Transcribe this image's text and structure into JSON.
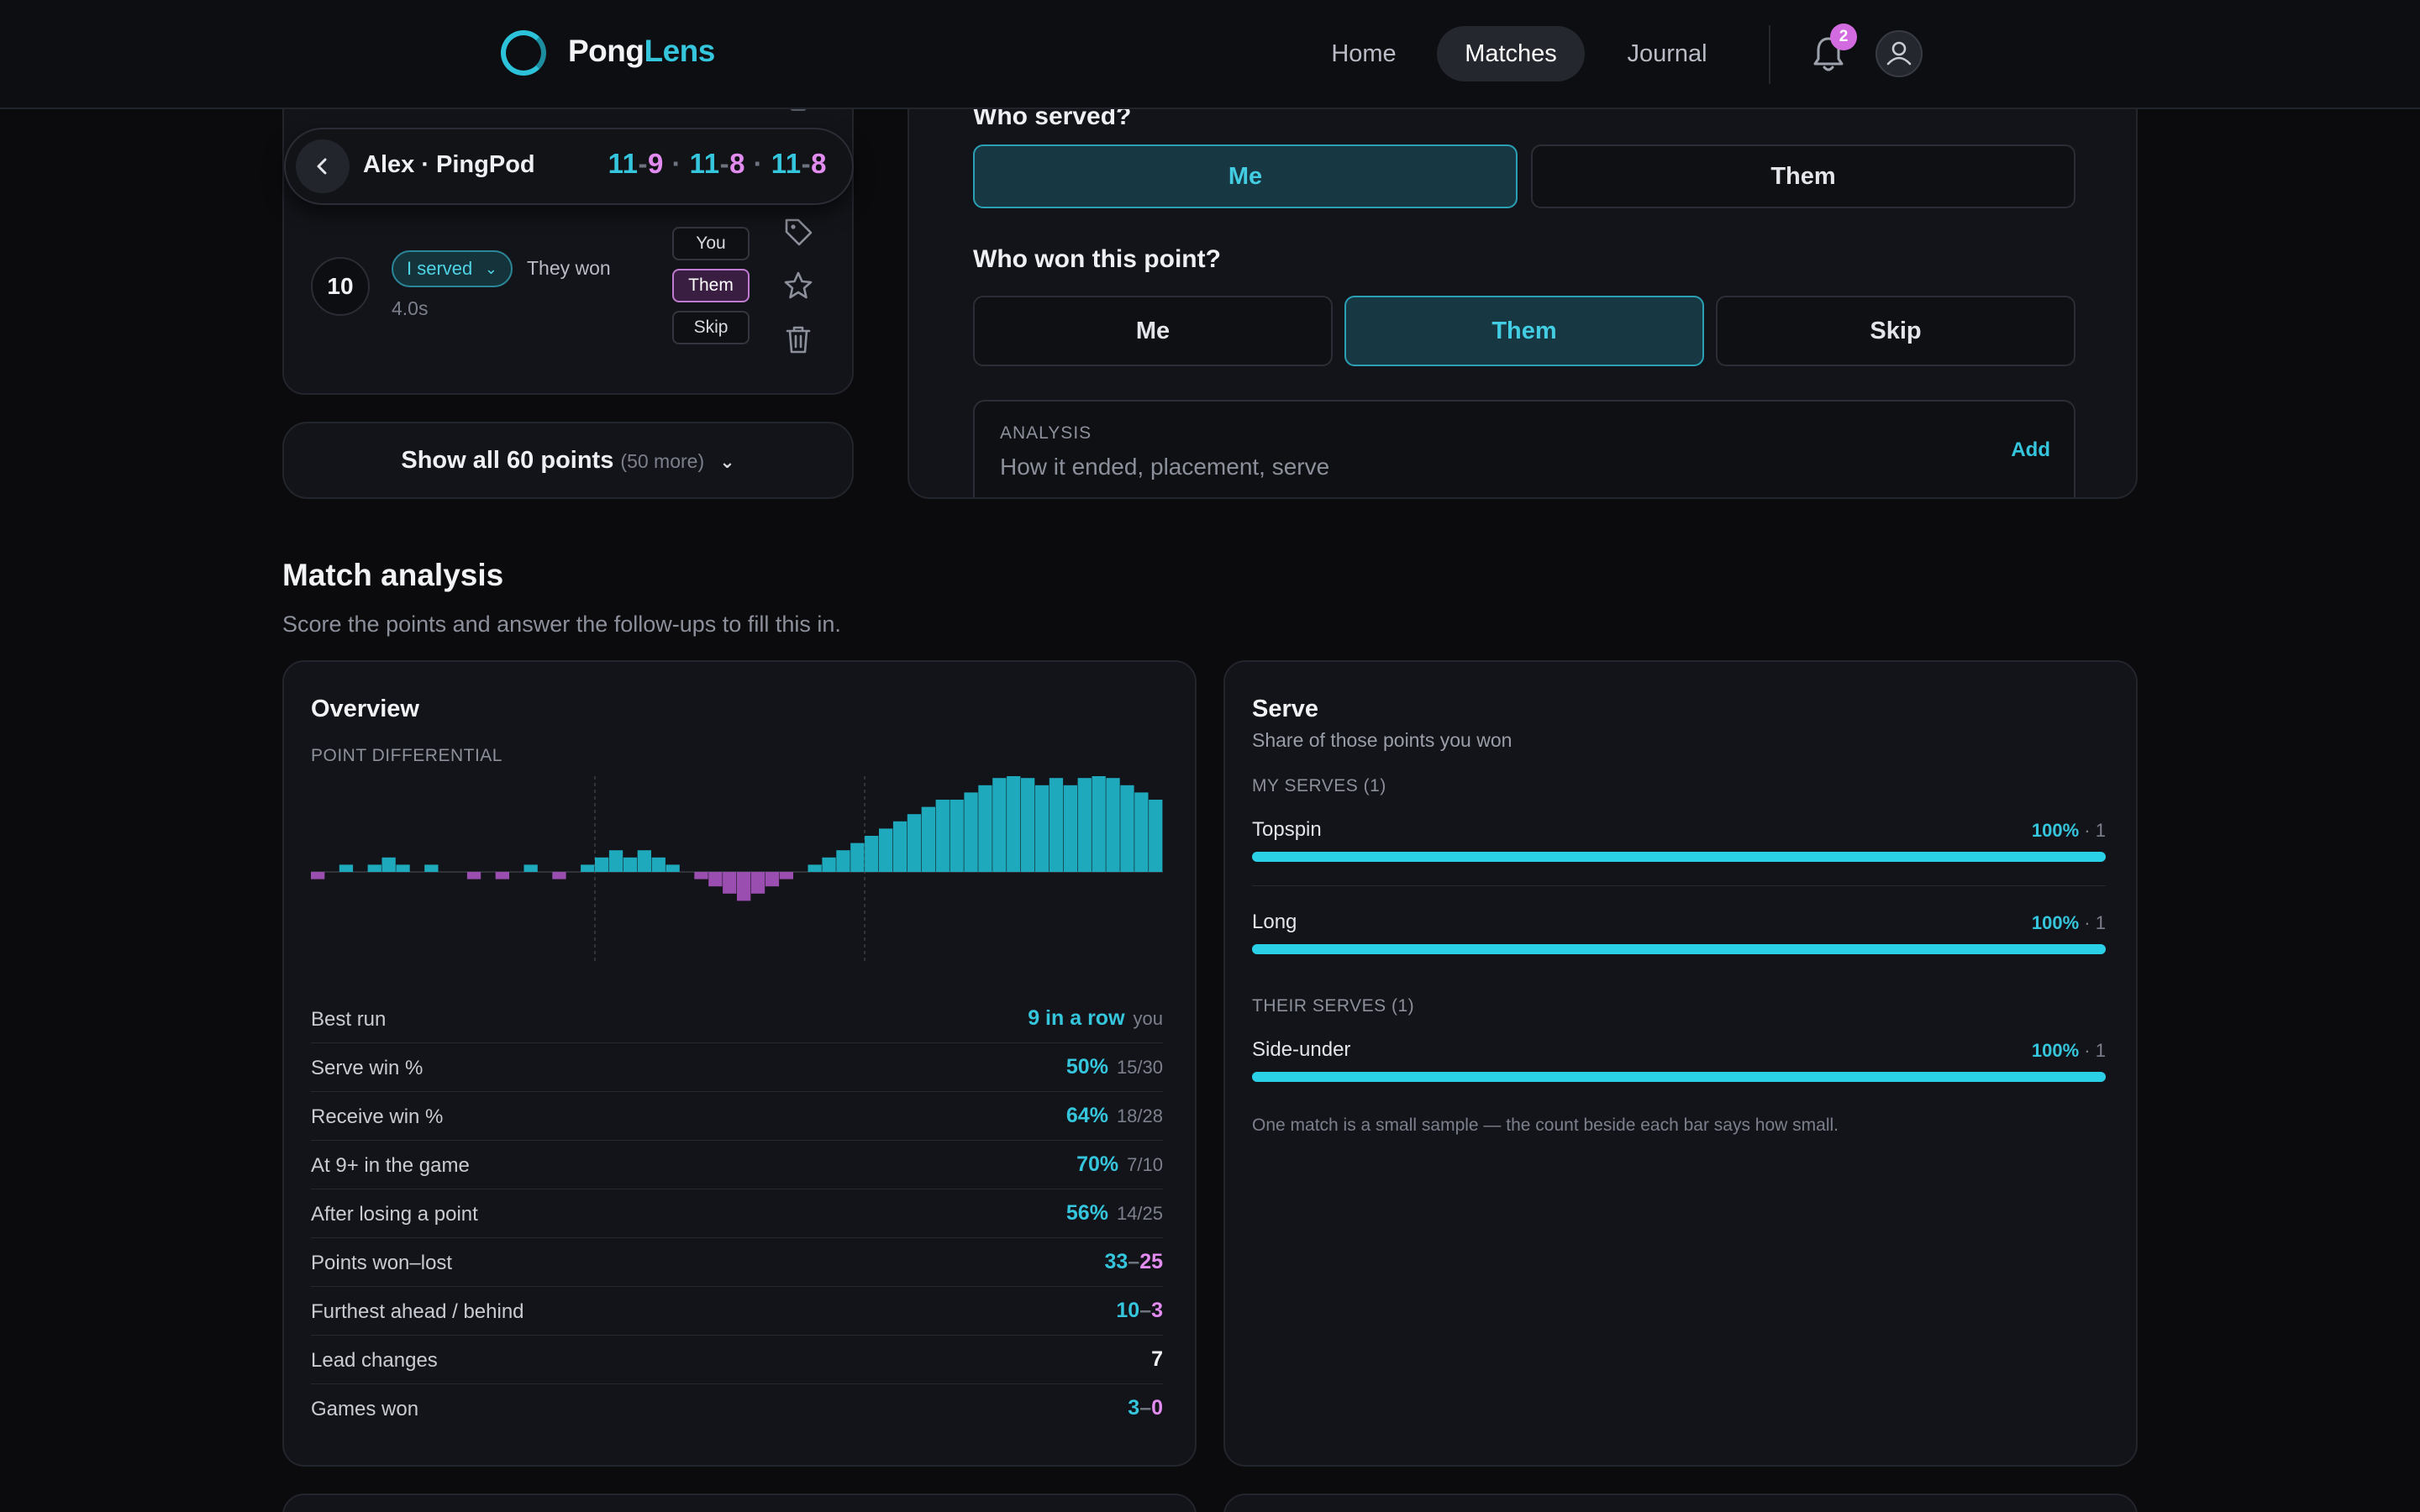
{
  "nav": {
    "brand_a": "Pong",
    "brand_b": "Lens",
    "links": [
      "Home",
      "Matches",
      "Journal"
    ],
    "notifications": "2",
    "icons": {
      "bell": "bell-icon",
      "avatar": "user-icon"
    }
  },
  "match_pill": {
    "title": "Alex · PingPod",
    "games": [
      {
        "me": "11",
        "them": "9"
      },
      {
        "me": "11",
        "them": "8"
      },
      {
        "me": "11",
        "them": "8"
      }
    ]
  },
  "point": {
    "number": "10",
    "served_chip": "I served",
    "result": "They won",
    "duration": "4.0s",
    "answers": [
      "You",
      "Them",
      "Skip"
    ],
    "selected_answer": "Them"
  },
  "show_all": {
    "label": "Show all 60 points",
    "more": "(50 more)"
  },
  "editor": {
    "q1": "Who served?",
    "q1_options": [
      "Me",
      "Them"
    ],
    "q1_selected": "Me",
    "q2": "Who won this point?",
    "q2_options": [
      "Me",
      "Them",
      "Skip"
    ],
    "q2_selected": "Them",
    "analysis_label": "ANALYSIS",
    "analysis_placeholder": "How it ended, placement, serve",
    "analysis_add": "Add"
  },
  "match_analysis": {
    "title": "Match analysis",
    "subtitle": "Score the points and answer the follow-ups to fill this in."
  },
  "overview": {
    "title": "Overview",
    "diff_label": "POINT DIFFERENTIAL",
    "stats": [
      {
        "label": "Best run",
        "value": "9 in a row",
        "sub": "you"
      },
      {
        "label": "Serve win %",
        "value": "50%",
        "sub": "15/30"
      },
      {
        "label": "Receive win %",
        "value": "64%",
        "sub": "18/28"
      },
      {
        "label": "At 9+ in the game",
        "value": "70%",
        "sub": "7/10"
      },
      {
        "label": "After losing a point",
        "value": "56%",
        "sub": "14/25"
      },
      {
        "label": "Points won–lost",
        "won": "33",
        "lost": "25"
      },
      {
        "label": "Furthest ahead / behind",
        "won": "10",
        "lost": "3"
      },
      {
        "label": "Lead changes",
        "plain": "7"
      },
      {
        "label": "Games won",
        "won": "3",
        "lost": "0"
      }
    ]
  },
  "chart_data": {
    "type": "bar",
    "colors": {
      "positive": "#1fa9bd",
      "negative": "#9a4fb0"
    },
    "game_boundaries_after_point": [
      20,
      39
    ],
    "values": [
      -1,
      0,
      1,
      0,
      1,
      2,
      1,
      0,
      1,
      0,
      0,
      -1,
      0,
      -1,
      0,
      1,
      0,
      -1,
      0,
      1,
      2,
      3,
      2,
      3,
      2,
      1,
      0,
      -1,
      -2,
      -3,
      -4,
      -3,
      -2,
      -1,
      0,
      1,
      2,
      3,
      4,
      5,
      6,
      7,
      8,
      9,
      10,
      10,
      11,
      12,
      13,
      14,
      13,
      12,
      13,
      12,
      13,
      14,
      13,
      12,
      11,
      10
    ]
  },
  "serve": {
    "title": "Serve",
    "subtitle": "Share of those points you won",
    "my_label": "MY SERVES (1)",
    "their_label": "THEIR SERVES (1)",
    "bars": [
      {
        "name": "Topspin",
        "pct": "100%",
        "count": "1",
        "fraction": 1.0
      },
      {
        "name": "Long",
        "pct": "100%",
        "count": "1",
        "fraction": 1.0
      },
      {
        "name": "Side-under",
        "pct": "100%",
        "count": "1",
        "fraction": 1.0
      }
    ],
    "note": "One match is a small sample — the count beside each bar says how small."
  }
}
